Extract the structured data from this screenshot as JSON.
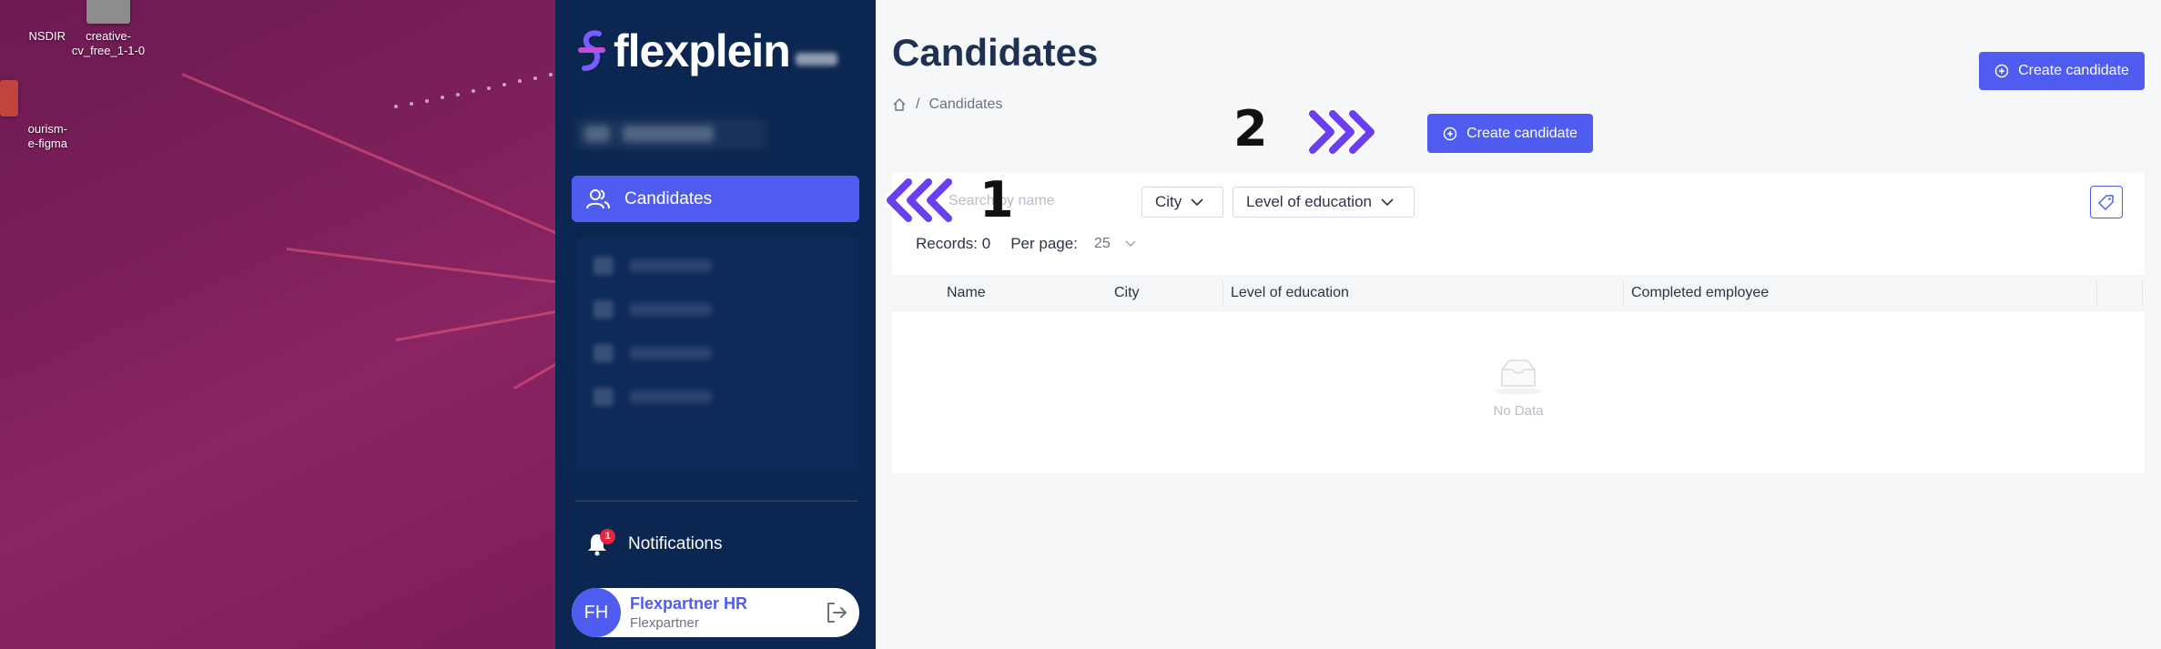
{
  "desktop": {
    "icons": [
      {
        "label_line1": "NSDIR",
        "label_line2": ""
      },
      {
        "label_line1": "creative-",
        "label_line2": "cv_free_1-1-0"
      },
      {
        "label_line1": "ourism-",
        "label_line2": "e-figma"
      }
    ]
  },
  "sidebar": {
    "logo_text": "flexplein",
    "active_item": {
      "label": "Candidates",
      "icon": "users-icon"
    },
    "notifications": {
      "label": "Notifications",
      "badge": "1"
    },
    "user": {
      "initials": "FH",
      "name": "Flexpartner HR",
      "org": "Flexpartner"
    }
  },
  "main": {
    "title": "Candidates",
    "breadcrumb": {
      "current": "Candidates",
      "separator": "/"
    },
    "create_button_label": "Create candidate",
    "create_button_label_2": "Create candidate",
    "search_placeholder": "Search by name",
    "filters": {
      "city": "City",
      "education": "Level of education"
    },
    "records_label": "Records: 0",
    "per_page_label": "Per page:",
    "per_page_value": "25",
    "columns": [
      "Name",
      "City",
      "Level of education",
      "Completed employee"
    ],
    "empty_text": "No Data"
  },
  "annotations": {
    "one": "1",
    "two": "2"
  },
  "colors": {
    "accent": "#4f5cf0",
    "sidebar": "#0b2650",
    "arrow": "#6a3ff0"
  }
}
